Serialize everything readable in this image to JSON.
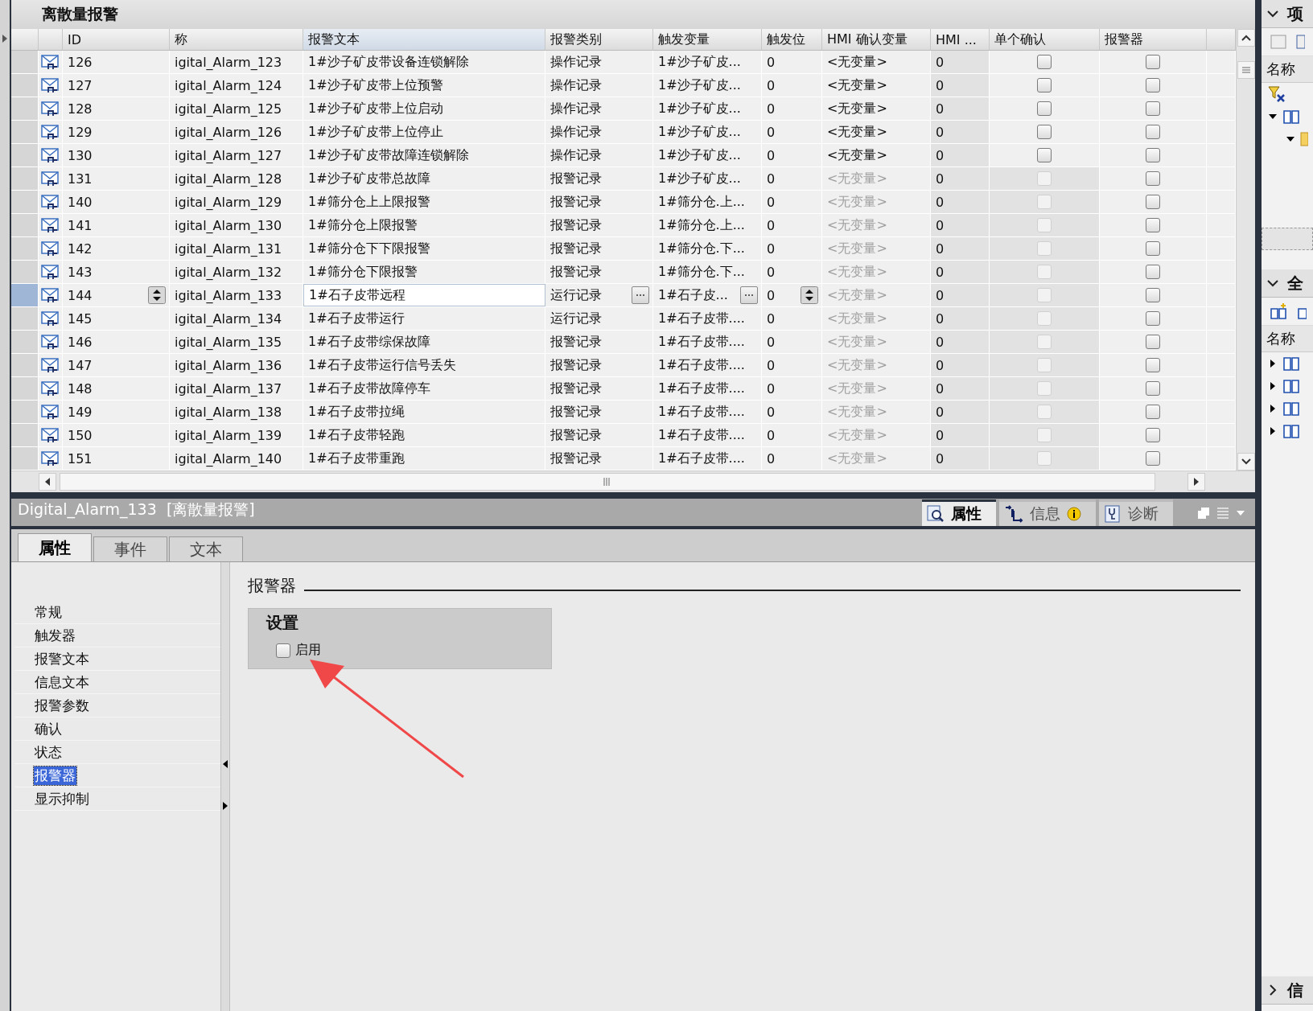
{
  "editor": {
    "title": "离散量报警"
  },
  "table": {
    "columns": [
      "ID",
      "称",
      "报警文本",
      "报警类别",
      "触发变量",
      "触发位",
      "HMI 确认变量",
      "HMI ...",
      "单个确认",
      "报警器"
    ],
    "rows": [
      {
        "id": "126",
        "name": "igital_Alarm_123",
        "text": "1#沙子矿皮带设备连锁解除",
        "class": "操作记录",
        "trigger_tag": "1#沙子矿皮...",
        "trigger_bit": "0",
        "ack_tag": "<无变量>",
        "hmi_bit": "0",
        "ack_enabled": true,
        "single_ack": false,
        "alarm_device": false,
        "selected": false
      },
      {
        "id": "127",
        "name": "igital_Alarm_124",
        "text": "1#沙子矿皮带上位预警",
        "class": "操作记录",
        "trigger_tag": "1#沙子矿皮...",
        "trigger_bit": "0",
        "ack_tag": "<无变量>",
        "hmi_bit": "0",
        "ack_enabled": true,
        "single_ack": false,
        "alarm_device": false,
        "selected": false
      },
      {
        "id": "128",
        "name": "igital_Alarm_125",
        "text": "1#沙子矿皮带上位启动",
        "class": "操作记录",
        "trigger_tag": "1#沙子矿皮...",
        "trigger_bit": "0",
        "ack_tag": "<无变量>",
        "hmi_bit": "0",
        "ack_enabled": true,
        "single_ack": false,
        "alarm_device": false,
        "selected": false
      },
      {
        "id": "129",
        "name": "igital_Alarm_126",
        "text": "1#沙子矿皮带上位停止",
        "class": "操作记录",
        "trigger_tag": "1#沙子矿皮...",
        "trigger_bit": "0",
        "ack_tag": "<无变量>",
        "hmi_bit": "0",
        "ack_enabled": true,
        "single_ack": false,
        "alarm_device": false,
        "selected": false
      },
      {
        "id": "130",
        "name": "igital_Alarm_127",
        "text": "1#沙子矿皮带故障连锁解除",
        "class": "操作记录",
        "trigger_tag": "1#沙子矿皮...",
        "trigger_bit": "0",
        "ack_tag": "<无变量>",
        "hmi_bit": "0",
        "ack_enabled": true,
        "single_ack": false,
        "alarm_device": false,
        "selected": false
      },
      {
        "id": "131",
        "name": "igital_Alarm_128",
        "text": "1#沙子矿皮带总故障",
        "class": "报警记录",
        "trigger_tag": "1#沙子矿皮...",
        "trigger_bit": "0",
        "ack_tag": "<无变量>",
        "hmi_bit": "0",
        "ack_enabled": false,
        "single_ack": false,
        "alarm_device": false,
        "selected": false
      },
      {
        "id": "140",
        "name": "igital_Alarm_129",
        "text": "1#筛分仓上上限报警",
        "class": "报警记录",
        "trigger_tag": "1#筛分仓.上...",
        "trigger_bit": "0",
        "ack_tag": "<无变量>",
        "hmi_bit": "0",
        "ack_enabled": false,
        "single_ack": false,
        "alarm_device": false,
        "selected": false
      },
      {
        "id": "141",
        "name": "igital_Alarm_130",
        "text": "1#筛分仓上限报警",
        "class": "报警记录",
        "trigger_tag": "1#筛分仓.上...",
        "trigger_bit": "0",
        "ack_tag": "<无变量>",
        "hmi_bit": "0",
        "ack_enabled": false,
        "single_ack": false,
        "alarm_device": false,
        "selected": false
      },
      {
        "id": "142",
        "name": "igital_Alarm_131",
        "text": "1#筛分仓下下限报警",
        "class": "报警记录",
        "trigger_tag": "1#筛分仓.下...",
        "trigger_bit": "0",
        "ack_tag": "<无变量>",
        "hmi_bit": "0",
        "ack_enabled": false,
        "single_ack": false,
        "alarm_device": false,
        "selected": false
      },
      {
        "id": "143",
        "name": "igital_Alarm_132",
        "text": "1#筛分仓下限报警",
        "class": "报警记录",
        "trigger_tag": "1#筛分仓.下...",
        "trigger_bit": "0",
        "ack_tag": "<无变量>",
        "hmi_bit": "0",
        "ack_enabled": false,
        "single_ack": false,
        "alarm_device": false,
        "selected": false
      },
      {
        "id": "144",
        "name": "igital_Alarm_133",
        "text": "1#石子皮带远程",
        "class": "运行记录",
        "trigger_tag": "1#石子皮...",
        "trigger_bit": "0",
        "ack_tag": "<无变量>",
        "hmi_bit": "0",
        "ack_enabled": false,
        "single_ack": false,
        "alarm_device": false,
        "selected": true
      },
      {
        "id": "145",
        "name": "igital_Alarm_134",
        "text": "1#石子皮带运行",
        "class": "运行记录",
        "trigger_tag": "1#石子皮带....",
        "trigger_bit": "0",
        "ack_tag": "<无变量>",
        "hmi_bit": "0",
        "ack_enabled": false,
        "single_ack": false,
        "alarm_device": false,
        "selected": false
      },
      {
        "id": "146",
        "name": "igital_Alarm_135",
        "text": "1#石子皮带综保故障",
        "class": "报警记录",
        "trigger_tag": "1#石子皮带....",
        "trigger_bit": "0",
        "ack_tag": "<无变量>",
        "hmi_bit": "0",
        "ack_enabled": false,
        "single_ack": false,
        "alarm_device": false,
        "selected": false
      },
      {
        "id": "147",
        "name": "igital_Alarm_136",
        "text": "1#石子皮带运行信号丢失",
        "class": "报警记录",
        "trigger_tag": "1#石子皮带....",
        "trigger_bit": "0",
        "ack_tag": "<无变量>",
        "hmi_bit": "0",
        "ack_enabled": false,
        "single_ack": false,
        "alarm_device": false,
        "selected": false
      },
      {
        "id": "148",
        "name": "igital_Alarm_137",
        "text": "1#石子皮带故障停车",
        "class": "报警记录",
        "trigger_tag": "1#石子皮带....",
        "trigger_bit": "0",
        "ack_tag": "<无变量>",
        "hmi_bit": "0",
        "ack_enabled": false,
        "single_ack": false,
        "alarm_device": false,
        "selected": false
      },
      {
        "id": "149",
        "name": "igital_Alarm_138",
        "text": "1#石子皮带拉绳",
        "class": "报警记录",
        "trigger_tag": "1#石子皮带....",
        "trigger_bit": "0",
        "ack_tag": "<无变量>",
        "hmi_bit": "0",
        "ack_enabled": false,
        "single_ack": false,
        "alarm_device": false,
        "selected": false
      },
      {
        "id": "150",
        "name": "igital_Alarm_139",
        "text": "1#石子皮带轻跑",
        "class": "报警记录",
        "trigger_tag": "1#石子皮带....",
        "trigger_bit": "0",
        "ack_tag": "<无变量>",
        "hmi_bit": "0",
        "ack_enabled": false,
        "single_ack": false,
        "alarm_device": false,
        "selected": false
      },
      {
        "id": "151",
        "name": "igital_Alarm_140",
        "text": "1#石子皮带重跑",
        "class": "报警记录",
        "trigger_tag": "1#石子皮带....",
        "trigger_bit": "0",
        "ack_tag": "<无变量>",
        "hmi_bit": "0",
        "ack_enabled": false,
        "single_ack": false,
        "alarm_device": false,
        "selected": false
      }
    ]
  },
  "inspector": {
    "title": "Digital_Alarm_133",
    "title_suffix": "[离散量报警]",
    "view_tabs": [
      {
        "label": "属性",
        "selected": true
      },
      {
        "label": "信息",
        "selected": false
      },
      {
        "label": "诊断",
        "selected": false
      }
    ],
    "tabs": [
      {
        "label": "属性",
        "selected": true
      },
      {
        "label": "事件",
        "selected": false
      },
      {
        "label": "文本",
        "selected": false
      }
    ],
    "nav": [
      {
        "label": "常规",
        "selected": false
      },
      {
        "label": "触发器",
        "selected": false
      },
      {
        "label": "报警文本",
        "selected": false
      },
      {
        "label": "信息文本",
        "selected": false
      },
      {
        "label": "报警参数",
        "selected": false
      },
      {
        "label": "确认",
        "selected": false
      },
      {
        "label": "状态",
        "selected": false
      },
      {
        "label": "报警器",
        "selected": true
      },
      {
        "label": "显示抑制",
        "selected": false
      }
    ],
    "section_title": "报警器",
    "group": {
      "title": "设置",
      "checkbox": {
        "label": "启用",
        "checked": false
      }
    }
  },
  "sidebar": {
    "sections": [
      {
        "title": "项",
        "column": "名称"
      },
      {
        "title": "全",
        "column": "名称"
      }
    ],
    "bottom_title": "信"
  }
}
